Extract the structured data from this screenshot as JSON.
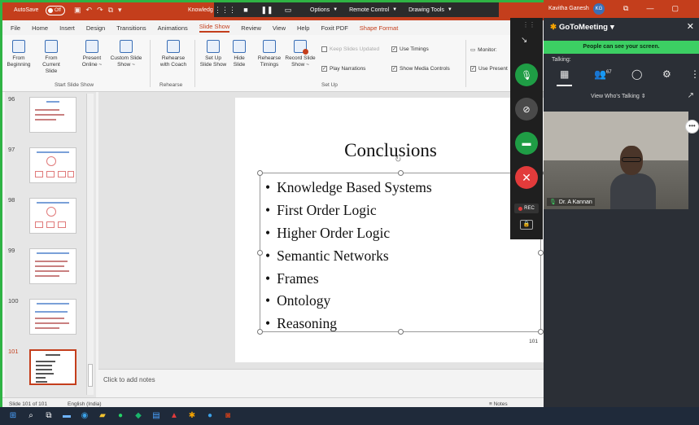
{
  "powerpoint": {
    "titlebar": {
      "autosave_label": "AutoSave",
      "autosave_state": "Off",
      "document_title": "Knowledg"
    },
    "slideshow_toolbar": {
      "options_label": "Options",
      "remote_control_label": "Remote Control",
      "drawing_tools_label": "Drawing Tools"
    },
    "tabs": [
      "File",
      "Home",
      "Insert",
      "Design",
      "Transitions",
      "Animations",
      "Slide Show",
      "Review",
      "View",
      "Help",
      "Foxit PDF",
      "Shape Format"
    ],
    "active_tab": "Slide Show",
    "ribbon": {
      "from_beginning": "From\nBeginning",
      "from_current": "From\nCurrent Slide",
      "present_online": "Present\nOnline ~",
      "custom_slide_show": "Custom Slide\nShow ~",
      "start_group": "Start Slide Show",
      "rehearse_coach": "Rehearse\nwith Coach",
      "rehearse_group": "Rehearse",
      "setup_show": "Set Up\nSlide Show",
      "hide_slide": "Hide\nSlide",
      "rehearse_timings": "Rehearse\nTimings",
      "record_slide_show": "Record Slide\nShow ~",
      "keep_slides_updated": "Keep Slides Updated",
      "play_narrations": "Play Narrations",
      "use_timings": "Use Timings",
      "show_media_controls": "Show Media Controls",
      "setup_group": "Set Up",
      "monitor": "Monitor:",
      "use_presenter": "Use Present"
    },
    "thumbnails": [
      "96",
      "97",
      "98",
      "99",
      "100",
      "101"
    ],
    "selected_slide": "101",
    "slide": {
      "title": "Conclusions",
      "bullets": [
        "Knowledge Based Systems",
        "First Order Logic",
        "Higher Order Logic",
        "Semantic Networks",
        "Frames",
        "Ontology",
        "Reasoning"
      ],
      "number": "101"
    },
    "notes_placeholder": "Click to add notes",
    "status": {
      "slide_count": "Slide 101 of 101",
      "language": "English (India)",
      "notes_label": "Notes"
    }
  },
  "gotomeeting": {
    "user_name": "Kavitha Ganesh",
    "user_initials": "KG",
    "app_name": "GoToMeeting",
    "screen_banner": "People can see your screen.",
    "talking_label": "Talking:",
    "participant_count": "67",
    "view_label": "View Who's Talking",
    "rec_label": "REC",
    "presenter_name": "Dr. A Kannan"
  }
}
